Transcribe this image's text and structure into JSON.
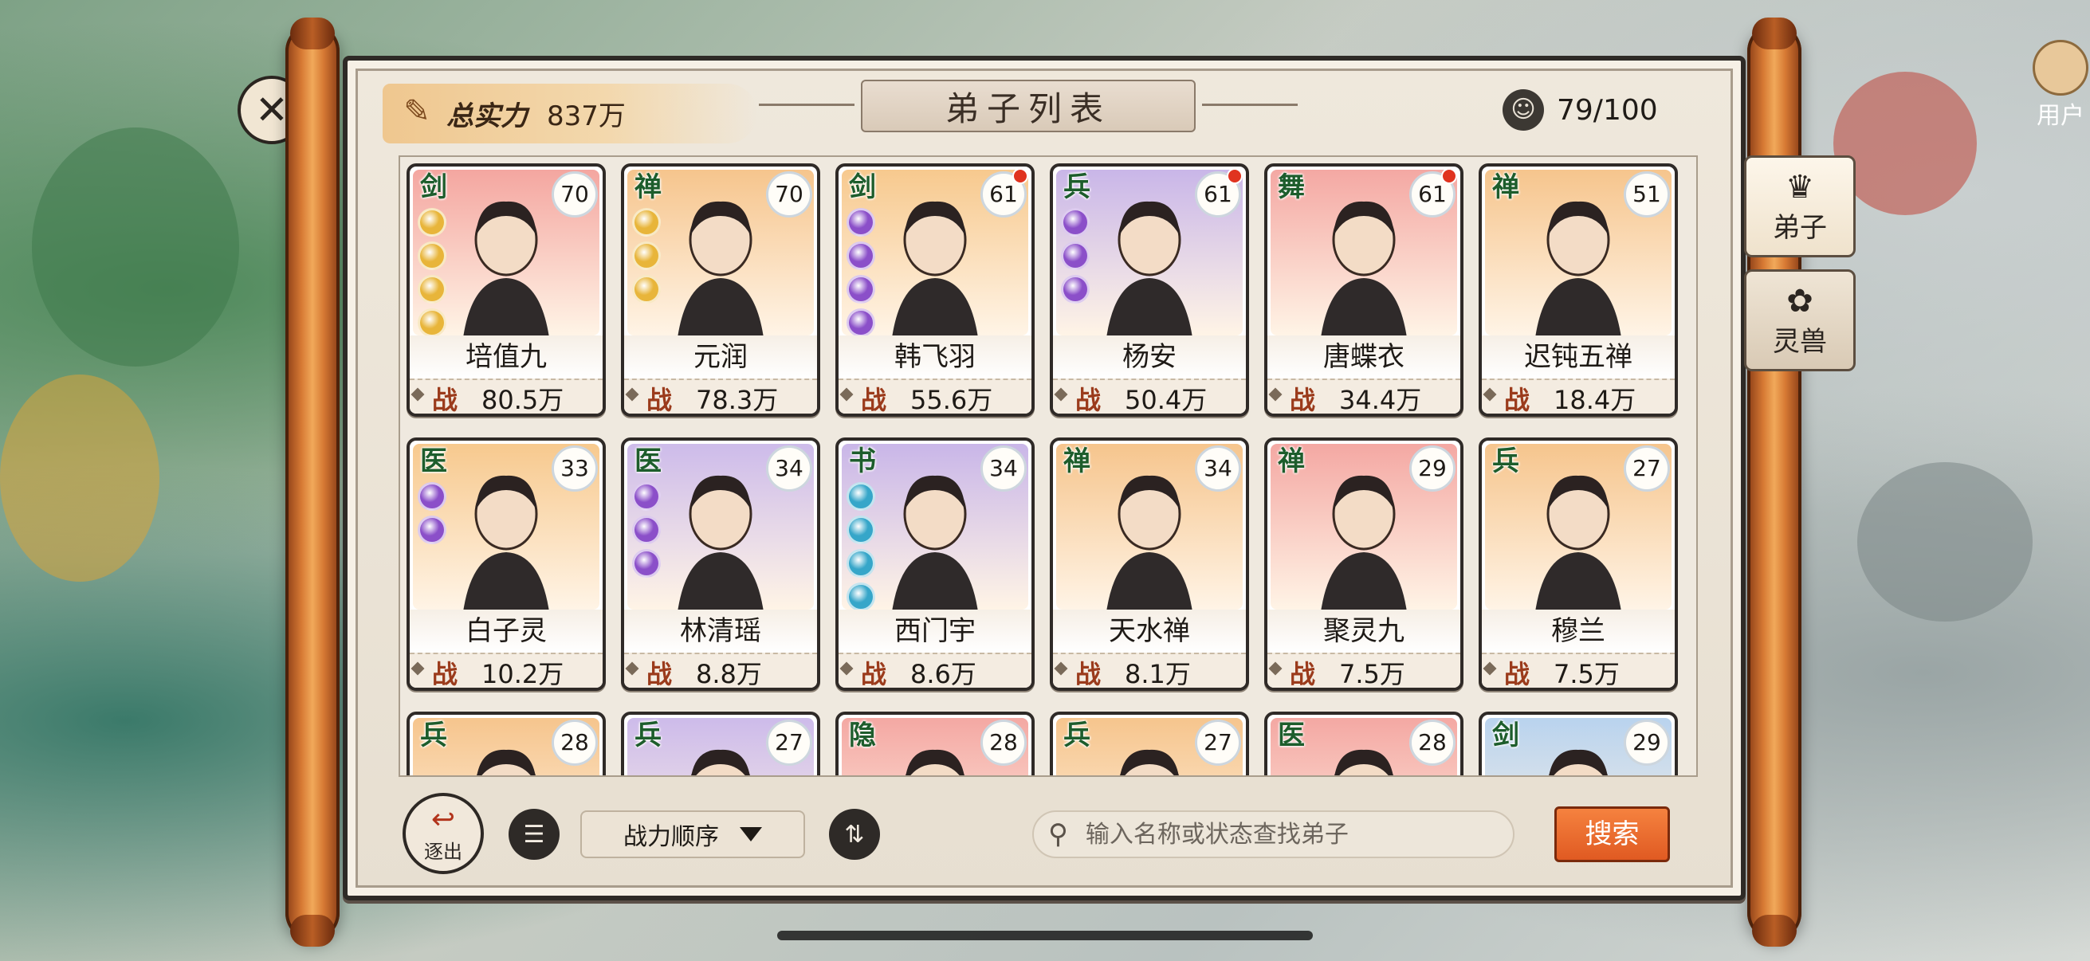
{
  "header": {
    "total_power_label": "总实力",
    "total_power_value": "837万",
    "title": "弟子列表",
    "disciple_count": "79/100"
  },
  "corner": {
    "user_label": "用户"
  },
  "side_tabs": [
    {
      "label": "弟子",
      "icon": "disciple-mask-icon",
      "active": true
    },
    {
      "label": "灵兽",
      "icon": "spirit-beast-icon",
      "active": false
    }
  ],
  "cards": [
    {
      "type": "剑",
      "level": "70",
      "name": "培值九",
      "power_label": "战",
      "power": "80.5万",
      "bg": "#f4a6a0",
      "gems": [
        "#e8b53a",
        "#e8b53a",
        "#e8b53a",
        "#e8b53a"
      ],
      "red_dot": false
    },
    {
      "type": "禅",
      "level": "70",
      "name": "元润",
      "power_label": "战",
      "power": "78.3万",
      "bg": "#f6c58d",
      "gems": [
        "#e8b53a",
        "#e8b53a",
        "#e8b53a"
      ],
      "red_dot": false
    },
    {
      "type": "剑",
      "level": "61",
      "name": "韩飞羽",
      "power_label": "战",
      "power": "55.6万",
      "bg": "#f7c98e",
      "gems": [
        "#8b4fc9",
        "#8b4fc9",
        "#8b4fc9",
        "#8b4fc9"
      ],
      "red_dot": true
    },
    {
      "type": "兵",
      "level": "61",
      "name": "杨安",
      "power_label": "战",
      "power": "50.4万",
      "bg": "#c9b6e8",
      "gems": [
        "#8b4fc9",
        "#8b4fc9",
        "#8b4fc9"
      ],
      "red_dot": true
    },
    {
      "type": "舞",
      "level": "61",
      "name": "唐蝶衣",
      "power_label": "战",
      "power": "34.4万",
      "bg": "#f4a8a3",
      "gems": [],
      "red_dot": true
    },
    {
      "type": "禅",
      "level": "51",
      "name": "迟钝五禅",
      "power_label": "战",
      "power": "18.4万",
      "bg": "#f6c58d",
      "gems": [],
      "red_dot": false
    },
    {
      "type": "医",
      "level": "33",
      "name": "白子灵",
      "power_label": "战",
      "power": "10.2万",
      "bg": "#f7c98e",
      "gems": [
        "#8b4fc9",
        "#8b4fc9"
      ],
      "red_dot": false
    },
    {
      "type": "医",
      "level": "34",
      "name": "林清瑶",
      "power_label": "战",
      "power": "8.8万",
      "bg": "#cdbbea",
      "gems": [
        "#8b4fc9",
        "#8b4fc9",
        "#8b4fc9"
      ],
      "red_dot": false
    },
    {
      "type": "书",
      "level": "34",
      "name": "西门宇",
      "power_label": "战",
      "power": "8.6万",
      "bg": "#c9b6e8",
      "gems": [
        "#36a6c9",
        "#36a6c9",
        "#36a6c9",
        "#36a6c9"
      ],
      "red_dot": false
    },
    {
      "type": "禅",
      "level": "34",
      "name": "天水禅",
      "power_label": "战",
      "power": "8.1万",
      "bg": "#f6c58d",
      "gems": [],
      "red_dot": false
    },
    {
      "type": "禅",
      "level": "29",
      "name": "聚灵九",
      "power_label": "战",
      "power": "7.5万",
      "bg": "#f4a8a3",
      "gems": [],
      "red_dot": false
    },
    {
      "type": "兵",
      "level": "27",
      "name": "穆兰",
      "power_label": "战",
      "power": "7.5万",
      "bg": "#f6c58d",
      "gems": [],
      "red_dot": false
    },
    {
      "type": "兵",
      "level": "28",
      "name": "",
      "power_label": "",
      "power": "",
      "bg": "#f6c58d",
      "gems": [],
      "red_dot": false
    },
    {
      "type": "兵",
      "level": "27",
      "name": "",
      "power_label": "",
      "power": "",
      "bg": "#cdbbea",
      "gems": [],
      "red_dot": false
    },
    {
      "type": "隐",
      "level": "28",
      "name": "",
      "power_label": "",
      "power": "",
      "bg": "#f4a8a3",
      "gems": [],
      "red_dot": false
    },
    {
      "type": "兵",
      "level": "27",
      "name": "",
      "power_label": "",
      "power": "",
      "bg": "#f6c58d",
      "gems": [],
      "red_dot": false
    },
    {
      "type": "医",
      "level": "28",
      "name": "",
      "power_label": "",
      "power": "",
      "bg": "#f4a8a3",
      "gems": [],
      "red_dot": false
    },
    {
      "type": "剑",
      "level": "29",
      "name": "",
      "power_label": "",
      "power": "",
      "bg": "#b9d3ee",
      "gems": [],
      "red_dot": false
    }
  ],
  "toolbar": {
    "expel_label": "逐出",
    "sort_label": "战力顺序",
    "search_placeholder": "输入名称或状态查找弟子",
    "search_button": "搜索"
  },
  "colors": {
    "accent_orange": "#e05a22",
    "frame_dark": "#2e2a26",
    "parchment": "#efe8dc"
  }
}
